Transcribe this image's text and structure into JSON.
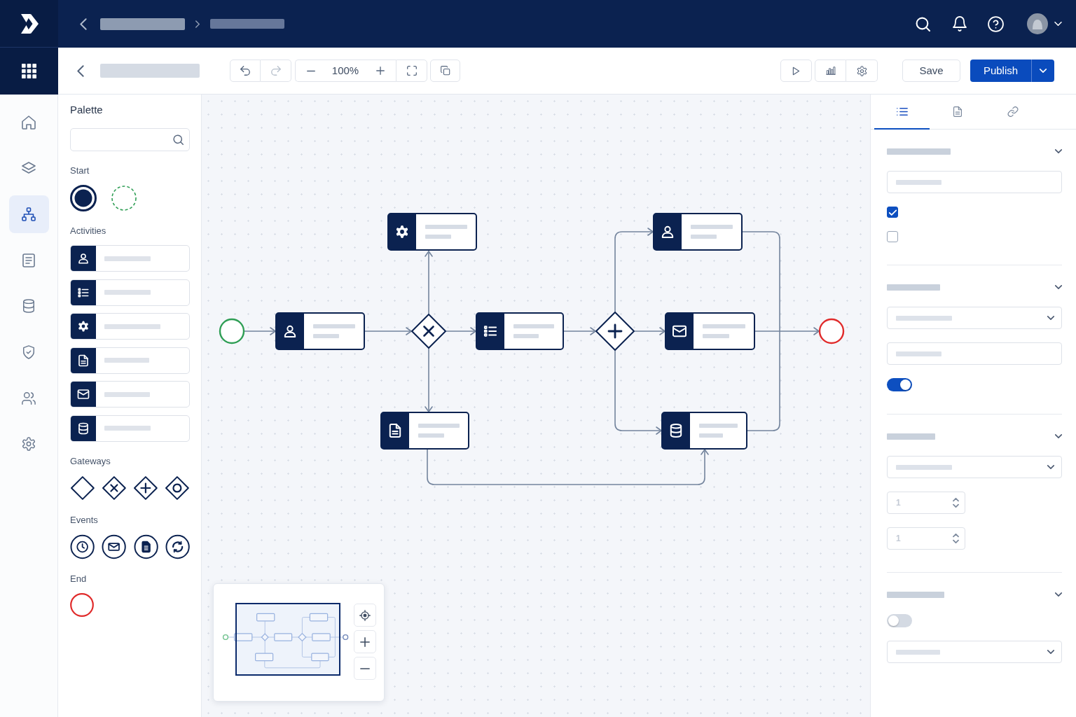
{
  "toolbar": {
    "undo": {
      "disabled": false
    },
    "redo": {
      "disabled": true
    },
    "zoom_level": "100%",
    "save_button": "Save",
    "publish_button": "Publish"
  },
  "nav": {
    "items": [
      {
        "selected": false
      },
      {
        "selected": false
      },
      {
        "selected": true
      },
      {
        "selected": false
      },
      {
        "selected": false
      },
      {
        "selected": false
      },
      {
        "selected": false
      },
      {
        "selected": false
      }
    ]
  },
  "palette": {
    "title": "Palette",
    "sections": [
      {
        "kind": "start",
        "label": "Start"
      },
      {
        "kind": "activities",
        "label": "Activities"
      },
      {
        "kind": "gateways",
        "label": "Gateways"
      },
      {
        "kind": "events",
        "label": "Events"
      },
      {
        "kind": "end",
        "label": "End"
      }
    ]
  },
  "properties": {
    "tabs": [
      {
        "selected": true
      },
      {
        "selected": false
      },
      {
        "selected": false
      }
    ],
    "sections": [
      {
        "controls": [
          {
            "kind": "text"
          },
          {
            "kind": "checkbox",
            "checked": true
          },
          {
            "kind": "checkbox",
            "checked": false
          }
        ]
      },
      {
        "controls": [
          {
            "kind": "select"
          },
          {
            "kind": "text"
          },
          {
            "kind": "toggle",
            "on": true
          }
        ]
      },
      {
        "controls": [
          {
            "kind": "select"
          },
          {
            "kind": "number",
            "placeholder": "1"
          },
          {
            "kind": "number",
            "placeholder": "1"
          }
        ]
      },
      {
        "controls": [
          {
            "kind": "toggle",
            "on": false
          },
          {
            "kind": "select"
          }
        ]
      }
    ]
  }
}
